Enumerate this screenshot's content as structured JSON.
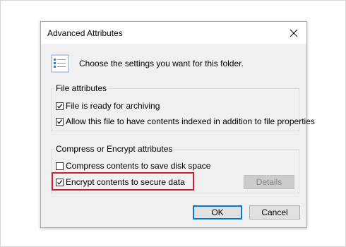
{
  "dialog": {
    "title": "Advanced Attributes",
    "header_text": "Choose the settings you want for this folder."
  },
  "icons": {
    "close": "close-icon",
    "settings_list": "settings-list-icon",
    "check": "checkmark-icon"
  },
  "file_attributes": {
    "label": "File attributes",
    "options": [
      {
        "label": "File is ready for archiving",
        "checked": true
      },
      {
        "label": "Allow this file to have contents indexed in addition to file properties",
        "checked": true
      }
    ]
  },
  "compress_encrypt": {
    "label": "Compress or Encrypt attributes",
    "options": [
      {
        "label": "Compress contents to save disk space",
        "checked": false
      },
      {
        "label": "Encrypt contents to secure data",
        "checked": true
      }
    ],
    "details_label": "Details"
  },
  "buttons": {
    "ok": "OK",
    "cancel": "Cancel"
  },
  "colors": {
    "highlight": "#d11f2f",
    "default_button_border": "#0078d7",
    "dialog_background": "#f0f0f0"
  }
}
